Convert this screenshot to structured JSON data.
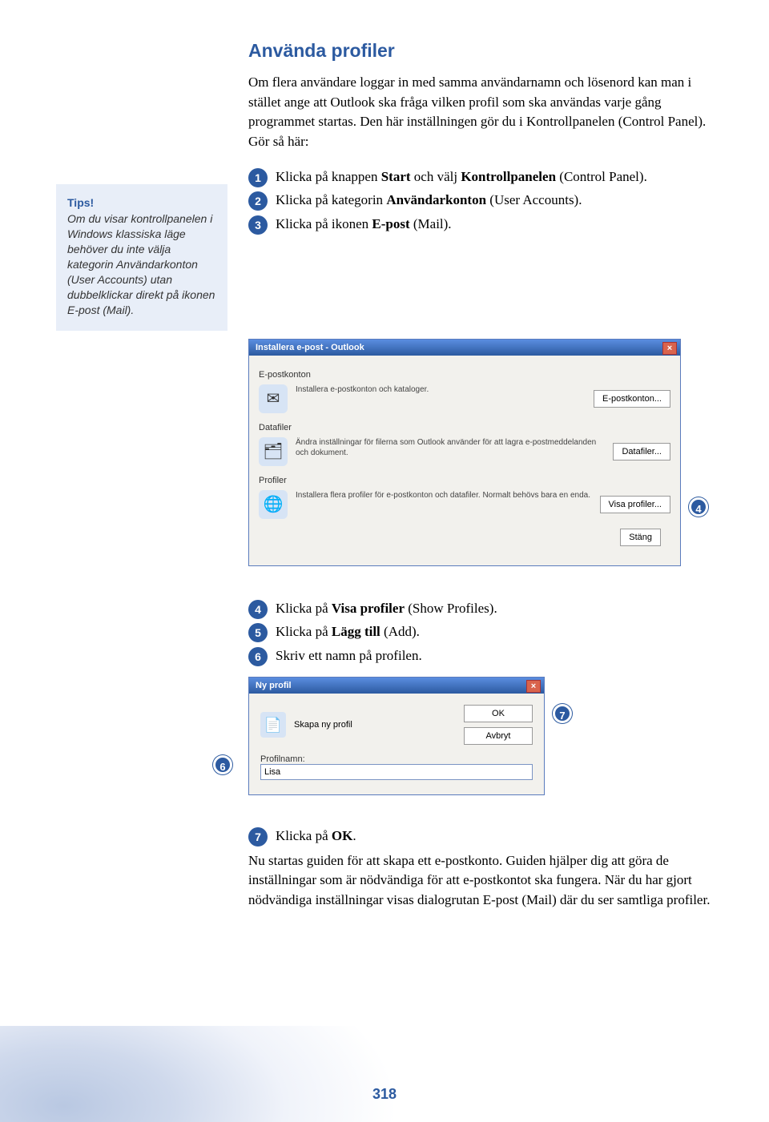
{
  "heading": "Använda profiler",
  "intro": "Om flera användare loggar in med samma användarnamn och lösenord kan man i stället ange att Outlook ska fråga vilken profil som ska användas varje gång programmet startas. Den här inställningen gör du i Kontrollpanelen (Control Panel). Gör så här:",
  "tip": {
    "title": "Tips!",
    "body": "Om du visar kontrollpanelen i Windows klassiska läge behöver du inte välja kategorin Användarkonton (User Accounts) utan dubbelklickar direkt på ikonen E-post (Mail)."
  },
  "steps_top": {
    "s1_pre": "Klicka på knappen ",
    "s1_b1": "Start",
    "s1_mid": " och välj ",
    "s1_b2": "Kontrollpanelen",
    "s1_post": " (Control Panel).",
    "s2_pre": "Klicka på kategorin ",
    "s2_b": "Användarkonton",
    "s2_post": " (User Accounts).",
    "s3_pre": "Klicka på ikonen ",
    "s3_b": "E-post",
    "s3_post": " (Mail)."
  },
  "dialog1": {
    "title": "Installera e-post - Outlook",
    "sec_epost": "E-postkonton",
    "row1_text": "Installera e-postkonton och kataloger.",
    "btn1": "E-postkonton...",
    "sec_datafiler": "Datafiler",
    "row2_text": "Ändra inställningar för filerna som Outlook använder för att lagra e-postmeddelanden och dokument.",
    "btn2": "Datafiler...",
    "sec_profiler": "Profiler",
    "row3_text": "Installera flera profiler för e-postkonton och datafiler. Normalt behövs bara en enda.",
    "btn3": "Visa profiler...",
    "btn_close": "Stäng"
  },
  "steps_mid": {
    "s4_pre": "Klicka på ",
    "s4_b": "Visa profiler",
    "s4_post": " (Show Profiles).",
    "s5_pre": "Klicka på ",
    "s5_b": "Lägg till",
    "s5_post": " (Add).",
    "s6": "Skriv ett namn på profilen."
  },
  "dialog2": {
    "title": "Ny profil",
    "prompt": "Skapa ny profil",
    "btn_ok": "OK",
    "btn_cancel": "Avbryt",
    "label": "Profilnamn:",
    "value": "Lisa"
  },
  "steps_end": {
    "s7_pre": "Klicka på ",
    "s7_b": "OK",
    "s7_post": "."
  },
  "final_p": "Nu startas guiden för att skapa ett e-postkonto. Guiden hjälper dig att göra de inställningar som är nödvändiga för att e-postkontot ska fungera. När du har gjort nödvändiga inställningar visas dialogrutan E-post (Mail) där du ser samtliga profiler.",
  "page_number": "318",
  "callouts": {
    "c4": "4",
    "c6": "6",
    "c7": "7"
  },
  "nums": {
    "n1": "1",
    "n2": "2",
    "n3": "3",
    "n4": "4",
    "n5": "5",
    "n6": "6",
    "n7": "7"
  }
}
